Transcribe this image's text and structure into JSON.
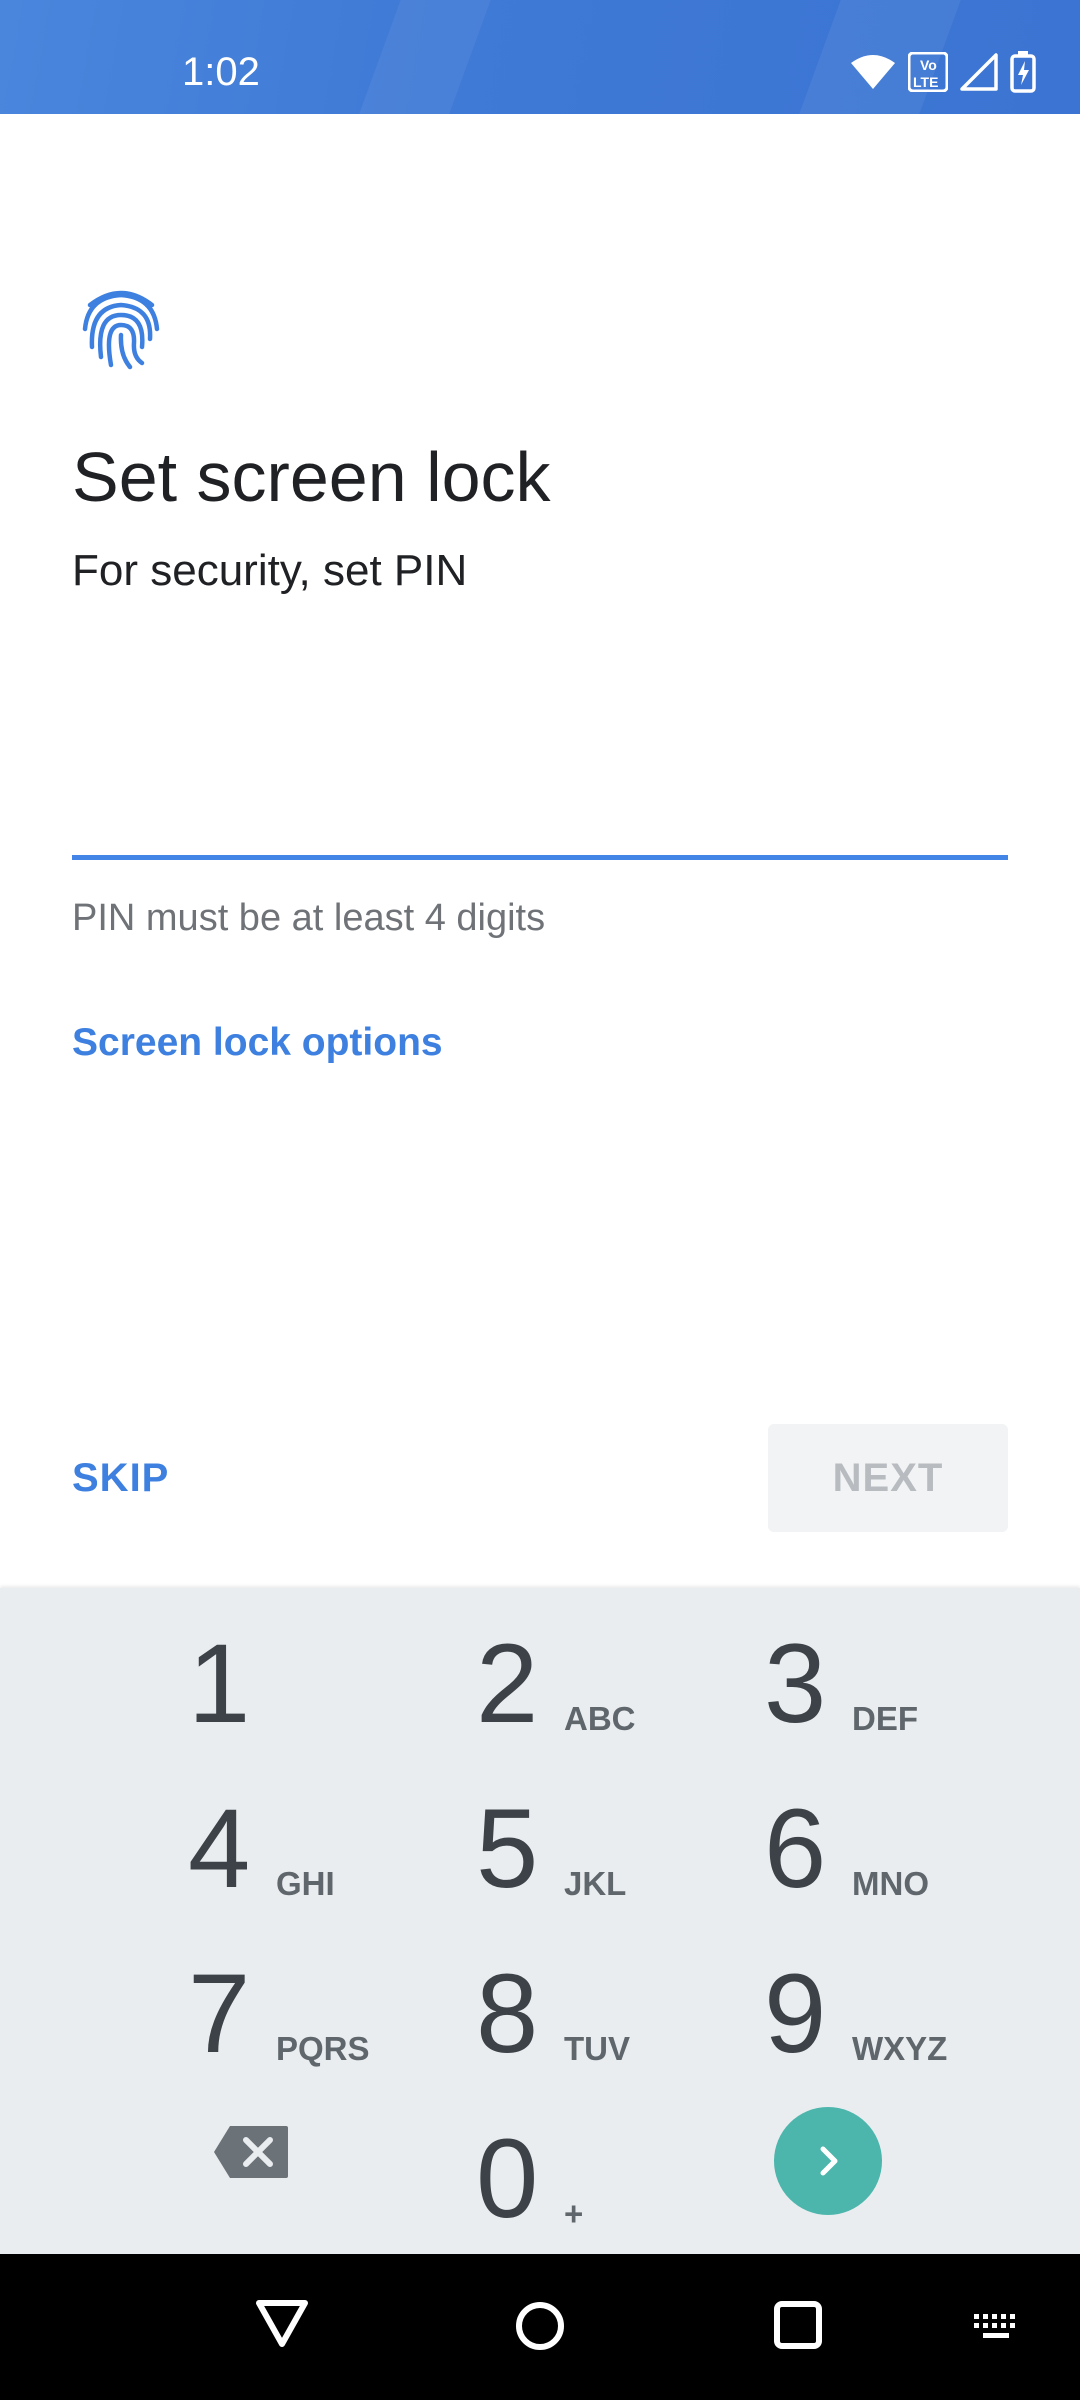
{
  "status_bar": {
    "time": "1:02",
    "icons": [
      "wifi-icon",
      "volte-icon",
      "signal-icon",
      "battery-charging-icon"
    ],
    "volte_text": {
      "top": "Vo",
      "bottom": "LTE"
    }
  },
  "header": {
    "icon": "fingerprint-icon",
    "title": "Set screen lock",
    "subtitle": "For security, set PIN"
  },
  "pin_field": {
    "value": "",
    "hint": "PIN must be at least 4 digits"
  },
  "links": {
    "screen_lock_options": "Screen lock options"
  },
  "actions": {
    "skip_label": "SKIP",
    "next_label": "NEXT"
  },
  "keypad": {
    "keys": [
      {
        "digit": "1",
        "letters": ""
      },
      {
        "digit": "2",
        "letters": "ABC"
      },
      {
        "digit": "3",
        "letters": "DEF"
      },
      {
        "digit": "4",
        "letters": "GHI"
      },
      {
        "digit": "5",
        "letters": "JKL"
      },
      {
        "digit": "6",
        "letters": "MNO"
      },
      {
        "digit": "7",
        "letters": "PQRS"
      },
      {
        "digit": "8",
        "letters": "TUV"
      },
      {
        "digit": "9",
        "letters": "WXYZ"
      },
      {
        "digit": "0",
        "letters": "+"
      }
    ],
    "backspace_icon": "backspace-icon",
    "enter_icon": "chevron-right-icon"
  },
  "nav_bar": {
    "icons": [
      "back-icon",
      "home-icon",
      "recents-icon",
      "keyboard-icon"
    ]
  },
  "colors": {
    "accent": "#3e80e0",
    "status_bar": "#3f7ad6",
    "keypad_bg": "#e9edf0",
    "enter_key": "#4db6ac"
  }
}
